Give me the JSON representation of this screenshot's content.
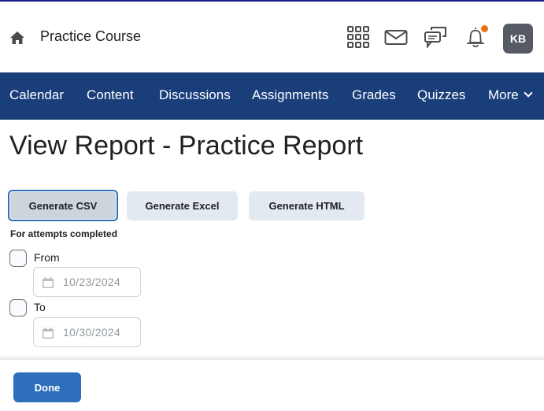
{
  "header": {
    "course_title": "Practice Course",
    "avatar_initials": "KB",
    "icons": [
      "home-icon",
      "waffle-grid-icon",
      "mail-icon",
      "chat-icon",
      "bell-icon"
    ],
    "notification_dot_color": "#e87511"
  },
  "navbar": {
    "background": "#193e7a",
    "items": [
      {
        "label": "Calendar"
      },
      {
        "label": "Content"
      },
      {
        "label": "Discussions"
      },
      {
        "label": "Assignments"
      },
      {
        "label": "Grades"
      },
      {
        "label": "Quizzes"
      },
      {
        "label": "More"
      }
    ]
  },
  "main": {
    "page_title": "View Report - Practice Report",
    "buttons": {
      "csv": "Generate CSV",
      "excel": "Generate Excel",
      "html": "Generate HTML"
    },
    "attempts_label": "For attempts completed",
    "from": {
      "label": "From",
      "checked": false,
      "date": "10/23/2024"
    },
    "to": {
      "label": "To",
      "checked": false,
      "date": "10/30/2024"
    }
  },
  "footer": {
    "done_label": "Done",
    "accent": "#2e6fbc"
  }
}
